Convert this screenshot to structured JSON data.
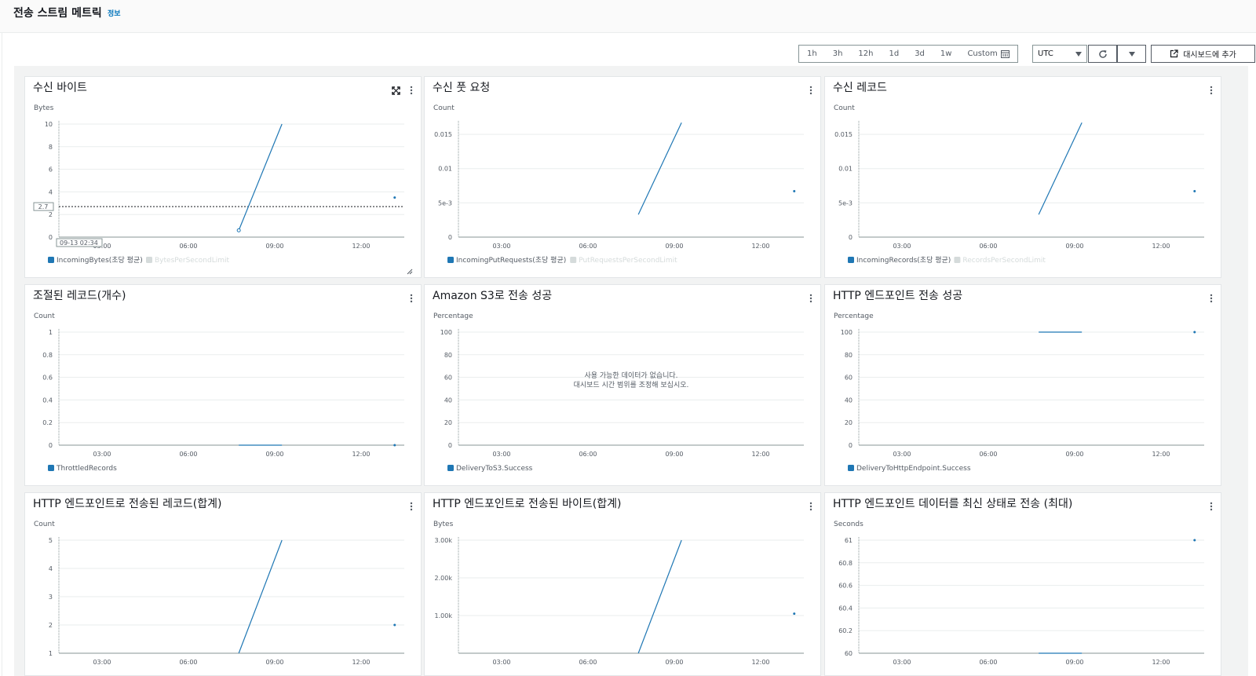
{
  "page": {
    "title": "전송 스트림 메트릭",
    "info_link": "정보"
  },
  "toolbar": {
    "time_ranges": [
      "1h",
      "3h",
      "12h",
      "1d",
      "3d",
      "1w"
    ],
    "custom_label": "Custom",
    "timezone": "UTC",
    "add_to_dashboard_label": "대시보드에 추가"
  },
  "colors": {
    "series": "#1f77b4",
    "grid": "#d5dbdb",
    "dim_legend": "#d5dbdb"
  },
  "widgets": [
    {
      "title": "수신 바이트",
      "unit": "Bytes",
      "expandable": true,
      "legend": [
        "IncomingBytes(초당 평균)",
        "BytesPerSecondLimit"
      ],
      "legend_dim": [
        false,
        true
      ],
      "hover_value": "2.7",
      "hover_time": "09-13 02:34"
    },
    {
      "title": "수신 풋 요청",
      "unit": "Count",
      "legend": [
        "IncomingPutRequests(초당 평균)",
        "PutRequestsPerSecondLimit"
      ],
      "legend_dim": [
        false,
        true
      ]
    },
    {
      "title": "수신 레코드",
      "unit": "Count",
      "legend": [
        "IncomingRecords(초당 평균)",
        "RecordsPerSecondLimit"
      ],
      "legend_dim": [
        false,
        true
      ]
    },
    {
      "title": "조절된 레코드(개수)",
      "unit": "Count",
      "legend": [
        "ThrottledRecords"
      ],
      "legend_dim": [
        false
      ]
    },
    {
      "title": "Amazon S3로 전송 성공",
      "unit": "Percentage",
      "legend": [
        "DeliveryToS3.Success"
      ],
      "legend_dim": [
        false
      ],
      "no_data": [
        "사용 가능한 데이터가 없습니다.",
        "대시보드 시간 범위를 조정해 보십시오."
      ]
    },
    {
      "title": "HTTP 엔드포인트 전송 성공",
      "unit": "Percentage",
      "legend": [
        "DeliveryToHttpEndpoint.Success"
      ],
      "legend_dim": [
        false
      ]
    },
    {
      "title": "HTTP 엔드포인트로 전송된 레코드(합계)",
      "unit": "Count",
      "legend": [],
      "legend_dim": []
    },
    {
      "title": "HTTP 엔드포인트로 전송된 바이트(합계)",
      "unit": "Bytes",
      "legend": [],
      "legend_dim": []
    },
    {
      "title": "HTTP 엔드포인트 데이터를 최신 상태로 전송 (최대)",
      "unit": "Seconds",
      "legend": [],
      "legend_dim": []
    }
  ],
  "chart_data": [
    {
      "type": "line",
      "title": "수신 바이트",
      "ylabel": "Bytes",
      "x_ticks": [
        "03:00",
        "06:00",
        "09:00",
        "12:00"
      ],
      "xlim": [
        "01:30",
        "13:30"
      ],
      "y_ticks": [
        "0",
        "2",
        "4",
        "6",
        "8",
        "10"
      ],
      "ylim": [
        0,
        10
      ],
      "series": [
        {
          "name": "IncomingBytes(초당 평균)",
          "points": [
            [
              "07:45",
              0.6
            ],
            [
              "09:15",
              10
            ]
          ],
          "dots": [
            [
              "13:10",
              3.5
            ]
          ]
        }
      ],
      "reference_line": 2.7
    },
    {
      "type": "line",
      "title": "수신 풋 요청",
      "ylabel": "Count",
      "x_ticks": [
        "03:00",
        "06:00",
        "09:00",
        "12:00"
      ],
      "xlim": [
        "01:30",
        "13:30"
      ],
      "y_ticks": [
        "0",
        "5e-3",
        "0.01",
        "0.015"
      ],
      "ylim": [
        0,
        0.0165
      ],
      "series": [
        {
          "name": "IncomingPutRequests(초당 평균)",
          "points": [
            [
              "07:45",
              0.0033
            ],
            [
              "09:15",
              0.0167
            ]
          ],
          "dots": [
            [
              "13:10",
              0.0067
            ]
          ]
        }
      ]
    },
    {
      "type": "line",
      "title": "수신 레코드",
      "ylabel": "Count",
      "x_ticks": [
        "03:00",
        "06:00",
        "09:00",
        "12:00"
      ],
      "xlim": [
        "01:30",
        "13:30"
      ],
      "y_ticks": [
        "0",
        "5e-3",
        "0.01",
        "0.015"
      ],
      "ylim": [
        0,
        0.0165
      ],
      "series": [
        {
          "name": "IncomingRecords(초당 평균)",
          "points": [
            [
              "07:45",
              0.0033
            ],
            [
              "09:15",
              0.0167
            ]
          ],
          "dots": [
            [
              "13:10",
              0.0067
            ]
          ]
        }
      ]
    },
    {
      "type": "line",
      "title": "조절된 레코드(개수)",
      "ylabel": "Count",
      "x_ticks": [
        "03:00",
        "06:00",
        "09:00",
        "12:00"
      ],
      "xlim": [
        "01:30",
        "13:30"
      ],
      "y_ticks": [
        "0",
        "0.2",
        "0.4",
        "0.6",
        "0.8",
        "1"
      ],
      "ylim": [
        0,
        1
      ],
      "series": [
        {
          "name": "ThrottledRecords",
          "points": [
            [
              "07:45",
              0
            ],
            [
              "09:15",
              0
            ]
          ],
          "dots": [
            [
              "13:10",
              0
            ]
          ]
        }
      ]
    },
    {
      "type": "line",
      "title": "Amazon S3로 전송 성공",
      "ylabel": "Percentage",
      "x_ticks": [
        "03:00",
        "06:00",
        "09:00",
        "12:00"
      ],
      "xlim": [
        "01:30",
        "13:30"
      ],
      "y_ticks": [
        "0",
        "20",
        "40",
        "60",
        "80",
        "100"
      ],
      "ylim": [
        0,
        100
      ],
      "series": []
    },
    {
      "type": "line",
      "title": "HTTP 엔드포인트 전송 성공",
      "ylabel": "Percentage",
      "x_ticks": [
        "03:00",
        "06:00",
        "09:00",
        "12:00"
      ],
      "xlim": [
        "01:30",
        "13:30"
      ],
      "y_ticks": [
        "0",
        "20",
        "40",
        "60",
        "80",
        "100"
      ],
      "ylim": [
        0,
        100
      ],
      "series": [
        {
          "name": "DeliveryToHttpEndpoint.Success",
          "points": [
            [
              "07:45",
              100
            ],
            [
              "09:15",
              100
            ]
          ],
          "dots": [
            [
              "13:10",
              100
            ]
          ]
        }
      ]
    },
    {
      "type": "line",
      "title": "HTTP 엔드포인트로 전송된 레코드(합계)",
      "ylabel": "Count",
      "x_ticks": [
        "03:00",
        "06:00",
        "09:00",
        "12:00"
      ],
      "xlim": [
        "01:30",
        "13:30"
      ],
      "y_ticks": [
        "1",
        "2",
        "3",
        "4",
        "5"
      ],
      "ylim": [
        1,
        5
      ],
      "series": [
        {
          "name": "",
          "points": [
            [
              "07:45",
              1
            ],
            [
              "09:15",
              5
            ]
          ],
          "dots": [
            [
              "13:10",
              2
            ]
          ]
        }
      ]
    },
    {
      "type": "line",
      "title": "HTTP 엔드포인트로 전송된 바이트(합계)",
      "ylabel": "Bytes",
      "x_ticks": [
        "03:00",
        "06:00",
        "09:00",
        "12:00"
      ],
      "xlim": [
        "01:30",
        "13:30"
      ],
      "y_ticks": [
        "1.00k",
        "2.00k",
        "3.00k"
      ],
      "ylim": [
        0,
        3000
      ],
      "series": [
        {
          "name": "",
          "points": [
            [
              "07:45",
              0
            ],
            [
              "09:15",
              3000
            ]
          ],
          "dots": [
            [
              "13:10",
              1050
            ]
          ]
        }
      ]
    },
    {
      "type": "line",
      "title": "HTTP 엔드포인트 데이터를 최신 상태로 전송 (최대)",
      "ylabel": "Seconds",
      "x_ticks": [
        "03:00",
        "06:00",
        "09:00",
        "12:00"
      ],
      "xlim": [
        "01:30",
        "13:30"
      ],
      "y_ticks": [
        "60",
        "60.2",
        "60.4",
        "60.6",
        "60.8",
        "61"
      ],
      "ylim": [
        60,
        61
      ],
      "series": [
        {
          "name": "",
          "points": [
            [
              "07:45",
              60
            ],
            [
              "09:15",
              60
            ]
          ],
          "dots": [
            [
              "13:10",
              61
            ]
          ]
        }
      ]
    }
  ]
}
